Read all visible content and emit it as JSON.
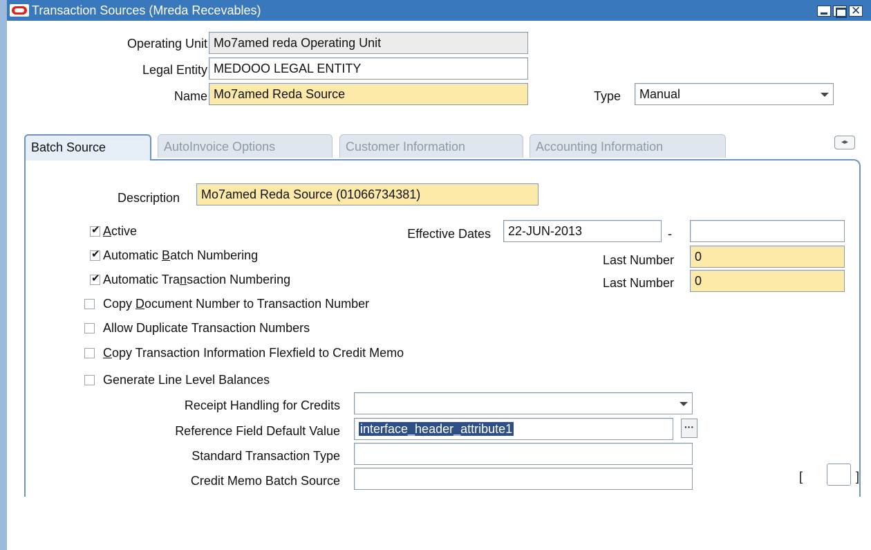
{
  "window": {
    "title": "Transaction Sources (Mreda Recevables)"
  },
  "header": {
    "operating_unit_label": "Operating Unit",
    "operating_unit_value": "Mo7amed reda Operating Unit",
    "legal_entity_label": "Legal Entity",
    "legal_entity_value": "MEDOOO LEGAL ENTITY",
    "name_label": "Name",
    "name_value": "Mo7amed Reda Source",
    "type_label": "Type",
    "type_value": "Manual"
  },
  "tabs": [
    {
      "label": "Batch Source",
      "active": true
    },
    {
      "label": "AutoInvoice Options",
      "active": false
    },
    {
      "label": "Customer Information",
      "active": false
    },
    {
      "label": "Accounting Information",
      "active": false
    }
  ],
  "tab_scroll_glyph": "◂▸",
  "batch_source": {
    "description_label": "Description",
    "description_value": "Mo7amed Reda Source  (01066734381)",
    "active": {
      "pre": "",
      "ul": "A",
      "post": "ctive",
      "checked": true
    },
    "effective_dates_label": "Effective Dates",
    "effective_date_from": "22-JUN-2013",
    "date_separator": "-",
    "effective_date_to": "",
    "auto_batch_numbering": {
      "pre": "Automatic ",
      "ul": "B",
      "post": "atch Numbering",
      "checked": true
    },
    "last_number_label_1": "Last Number",
    "last_number_value_1": "0",
    "auto_transaction_numbering": {
      "pre": "Automatic Tra",
      "ul": "n",
      "post": "saction Numbering",
      "checked": true
    },
    "last_number_label_2": "Last Number",
    "last_number_value_2": "0",
    "copy_document_number": {
      "pre": "Copy ",
      "ul": "D",
      "post": "ocument Number to Transaction Number",
      "checked": false
    },
    "allow_duplicate": {
      "pre": "",
      "ul": "",
      "post": "Allow Duplicate Transaction Numbers",
      "checked": false
    },
    "copy_flexfield": {
      "pre": "",
      "ul": "C",
      "post": "opy Transaction Information Flexfield to Credit Memo",
      "checked": false
    },
    "generate_line_balances": {
      "pre": "",
      "ul": "",
      "post": "Generate Line Level Balances",
      "checked": false
    },
    "receipt_handling_label": "Receipt Handling for Credits",
    "receipt_handling_value": "",
    "reference_field_label": "Reference Field Default Value",
    "reference_field_value": "interface_header_attribute1",
    "lov_glyph": "···",
    "standard_txn_type_label": "Standard Transaction Type",
    "standard_txn_type_value": "",
    "credit_memo_batch_label": "Credit Memo Batch Source",
    "credit_memo_batch_value": "",
    "bracket_open": "[",
    "bracket_close": "]"
  },
  "colors": {
    "titlebar": "#3a78be",
    "required_field": "#fde9a8",
    "readonly_field": "#ececec",
    "selection": "#2d4f86",
    "tab_border": "#6c93c4"
  }
}
